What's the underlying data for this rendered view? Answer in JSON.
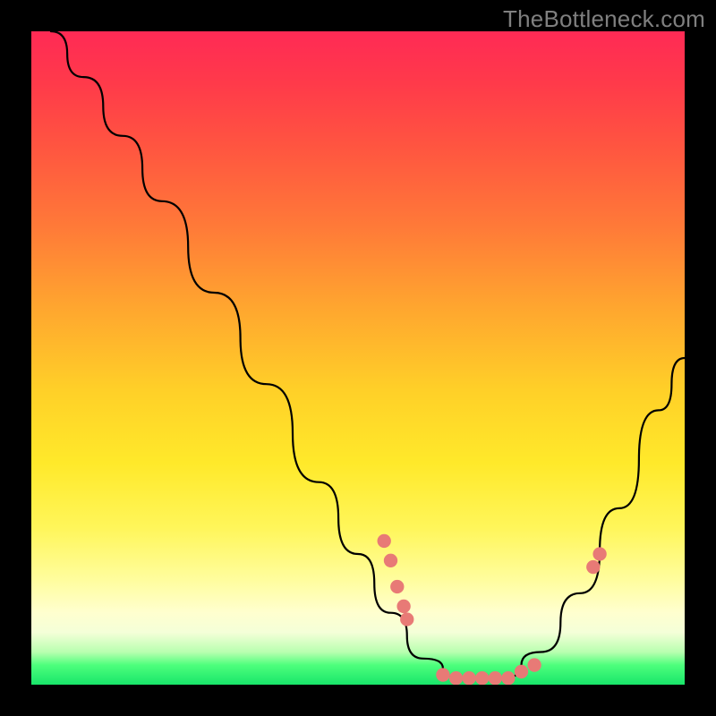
{
  "watermark": "TheBottleneck.com",
  "chart_data": {
    "type": "line",
    "title": "",
    "xlabel": "",
    "ylabel": "",
    "xlim": [
      0,
      100
    ],
    "ylim": [
      0,
      100
    ],
    "grid": false,
    "legend": false,
    "curve": [
      {
        "x": 3,
        "y": 100
      },
      {
        "x": 8,
        "y": 93
      },
      {
        "x": 14,
        "y": 84
      },
      {
        "x": 20,
        "y": 74
      },
      {
        "x": 28,
        "y": 60
      },
      {
        "x": 36,
        "y": 46
      },
      {
        "x": 44,
        "y": 31
      },
      {
        "x": 50,
        "y": 20
      },
      {
        "x": 55,
        "y": 11
      },
      {
        "x": 60,
        "y": 4
      },
      {
        "x": 66,
        "y": 1
      },
      {
        "x": 72,
        "y": 1
      },
      {
        "x": 78,
        "y": 5
      },
      {
        "x": 84,
        "y": 14
      },
      {
        "x": 90,
        "y": 27
      },
      {
        "x": 96,
        "y": 42
      },
      {
        "x": 100,
        "y": 50
      }
    ],
    "markers": [
      {
        "x": 54,
        "y": 22
      },
      {
        "x": 55,
        "y": 19
      },
      {
        "x": 56,
        "y": 15
      },
      {
        "x": 57,
        "y": 12
      },
      {
        "x": 57.5,
        "y": 10
      },
      {
        "x": 63,
        "y": 1.5
      },
      {
        "x": 65,
        "y": 1
      },
      {
        "x": 67,
        "y": 1
      },
      {
        "x": 69,
        "y": 1
      },
      {
        "x": 71,
        "y": 1
      },
      {
        "x": 73,
        "y": 1
      },
      {
        "x": 75,
        "y": 2
      },
      {
        "x": 77,
        "y": 3
      },
      {
        "x": 86,
        "y": 18
      },
      {
        "x": 87,
        "y": 20
      }
    ],
    "marker_color": "#e87a76",
    "background_gradient": {
      "top": "#ff2a55",
      "bottom": "#18e56a"
    }
  }
}
